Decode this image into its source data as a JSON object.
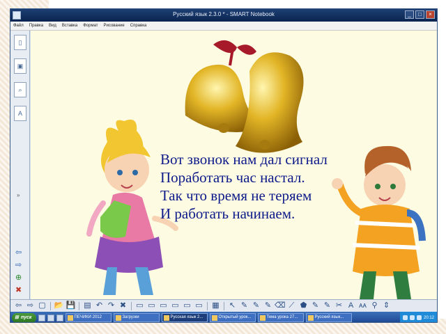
{
  "window": {
    "title": "Русский язык 2.3.0 * - SMART Notebook",
    "controls": [
      "_",
      "□",
      "×"
    ]
  },
  "menu": [
    {
      "label": "Файл"
    },
    {
      "label": "Правка"
    },
    {
      "label": "Вид"
    },
    {
      "label": "Вставка"
    },
    {
      "label": "Формат"
    },
    {
      "label": "Рисование"
    },
    {
      "label": "Справка"
    }
  ],
  "sidebar": {
    "tabs": [
      {
        "icon": "page-sorter-icon",
        "glyph": "▯"
      },
      {
        "icon": "gallery-icon",
        "glyph": "▣"
      },
      {
        "icon": "attachments-icon",
        "glyph": "⌕"
      },
      {
        "icon": "properties-icon",
        "glyph": "A"
      }
    ],
    "collapse_glyph": "»",
    "nav": [
      "⇦",
      "⇨",
      "⊕",
      "✖"
    ]
  },
  "slide": {
    "poem": [
      "Вот звонок нам дал сигнал",
      "Поработать час настал.",
      "Так что время не теряем",
      "И работать начинаем."
    ]
  },
  "toolbar": {
    "buttons": [
      "⇦",
      "⇨",
      "▢",
      "|",
      "📂",
      "💾",
      "|",
      "▤",
      "↶",
      "↷",
      "✖",
      "|",
      "▭",
      "▭",
      "▭",
      "▭",
      "▭",
      "▭",
      "|",
      "▦",
      "|",
      "↖",
      "✎",
      "✎",
      "✎",
      "⌫",
      "⟋",
      "⬟",
      "✎",
      "✎",
      "✂",
      "A",
      "ᴀᴀ",
      "⚲",
      "⇕"
    ]
  },
  "taskbar": {
    "start_label": "пуск",
    "tasks": [
      {
        "label": "ПЕЧИКИ 2012"
      },
      {
        "label": "Загрузки"
      },
      {
        "label": "Русская язык 2..."
      },
      {
        "label": "Открытый урок..."
      },
      {
        "label": "Тема урока 27..."
      },
      {
        "label": "Русский язык..."
      }
    ],
    "clock": "20:12"
  }
}
